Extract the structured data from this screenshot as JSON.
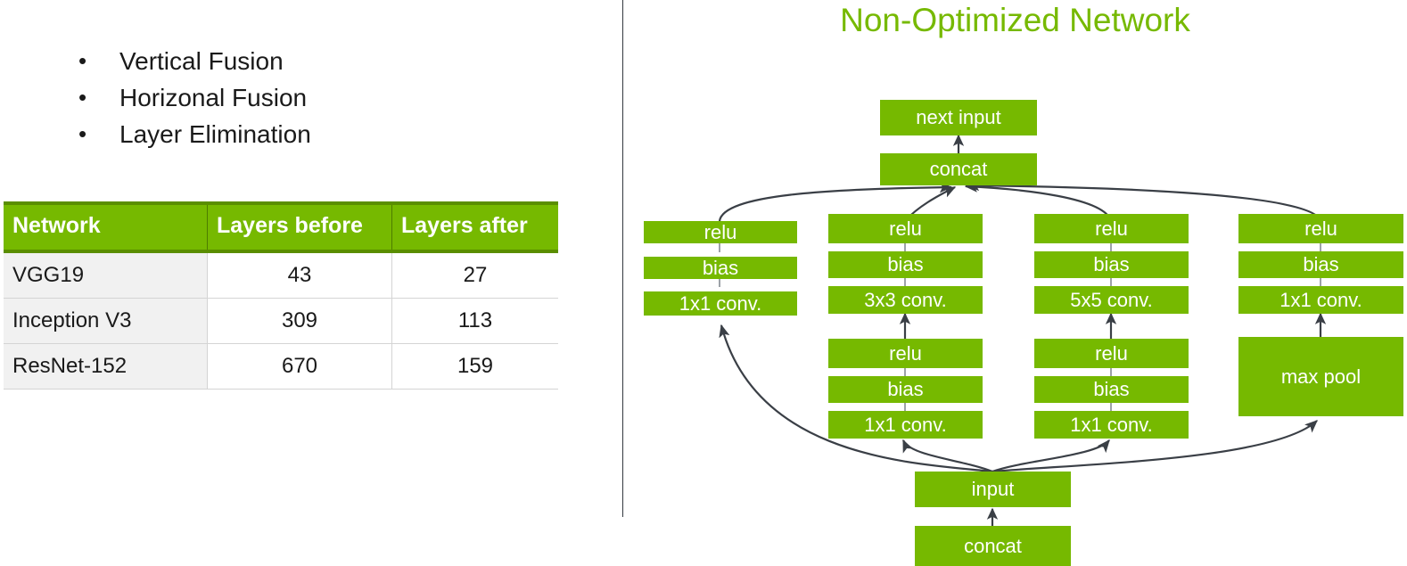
{
  "theme": {
    "green": "#76b900",
    "green_dark": "#5a8e00",
    "text": "#1a1a1a",
    "row_alt": "#f1f1f1",
    "arrow": "#3a3f46"
  },
  "bullets": [
    {
      "marker": "•",
      "label": "Vertical Fusion"
    },
    {
      "marker": "•",
      "label": "Horizonal Fusion"
    },
    {
      "marker": "•",
      "label": "Layer Elimination"
    }
  ],
  "table": {
    "headers": [
      "Network",
      "Layers before",
      "Layers after"
    ],
    "rows": [
      {
        "network": "VGG19",
        "before": "43",
        "after": "27"
      },
      {
        "network": "Inception V3",
        "before": "309",
        "after": "113"
      },
      {
        "network": "ResNet-152",
        "before": "670",
        "after": "159"
      }
    ]
  },
  "diagram": {
    "title": "Non-Optimized Network",
    "top_nodes": [
      {
        "id": "next-input",
        "label": "next input"
      },
      {
        "id": "concat-top",
        "label": "concat"
      }
    ],
    "branches": [
      {
        "id": "branch-1",
        "upper": [
          {
            "id": "b1-relu",
            "label": "relu"
          },
          {
            "id": "b1-bias",
            "label": "bias"
          },
          {
            "id": "b1-conv",
            "label": "1x1 conv."
          }
        ],
        "lower": []
      },
      {
        "id": "branch-2",
        "upper": [
          {
            "id": "b2-relu",
            "label": "relu"
          },
          {
            "id": "b2-bias",
            "label": "bias"
          },
          {
            "id": "b2-conv",
            "label": "3x3 conv."
          }
        ],
        "lower": [
          {
            "id": "b2-relu2",
            "label": "relu"
          },
          {
            "id": "b2-bias2",
            "label": "bias"
          },
          {
            "id": "b2-conv2",
            "label": "1x1 conv."
          }
        ]
      },
      {
        "id": "branch-3",
        "upper": [
          {
            "id": "b3-relu",
            "label": "relu"
          },
          {
            "id": "b3-bias",
            "label": "bias"
          },
          {
            "id": "b3-conv",
            "label": "5x5 conv."
          }
        ],
        "lower": [
          {
            "id": "b3-relu2",
            "label": "relu"
          },
          {
            "id": "b3-bias2",
            "label": "bias"
          },
          {
            "id": "b3-conv2",
            "label": "1x1 conv."
          }
        ]
      },
      {
        "id": "branch-4",
        "upper": [
          {
            "id": "b4-relu",
            "label": "relu"
          },
          {
            "id": "b4-bias",
            "label": "bias"
          },
          {
            "id": "b4-conv",
            "label": "1x1 conv."
          }
        ],
        "lower": [
          {
            "id": "b4-maxpool",
            "label": "max pool"
          }
        ]
      }
    ],
    "bottom_nodes": [
      {
        "id": "input",
        "label": "input"
      },
      {
        "id": "concat-bottom",
        "label": "concat"
      }
    ]
  }
}
